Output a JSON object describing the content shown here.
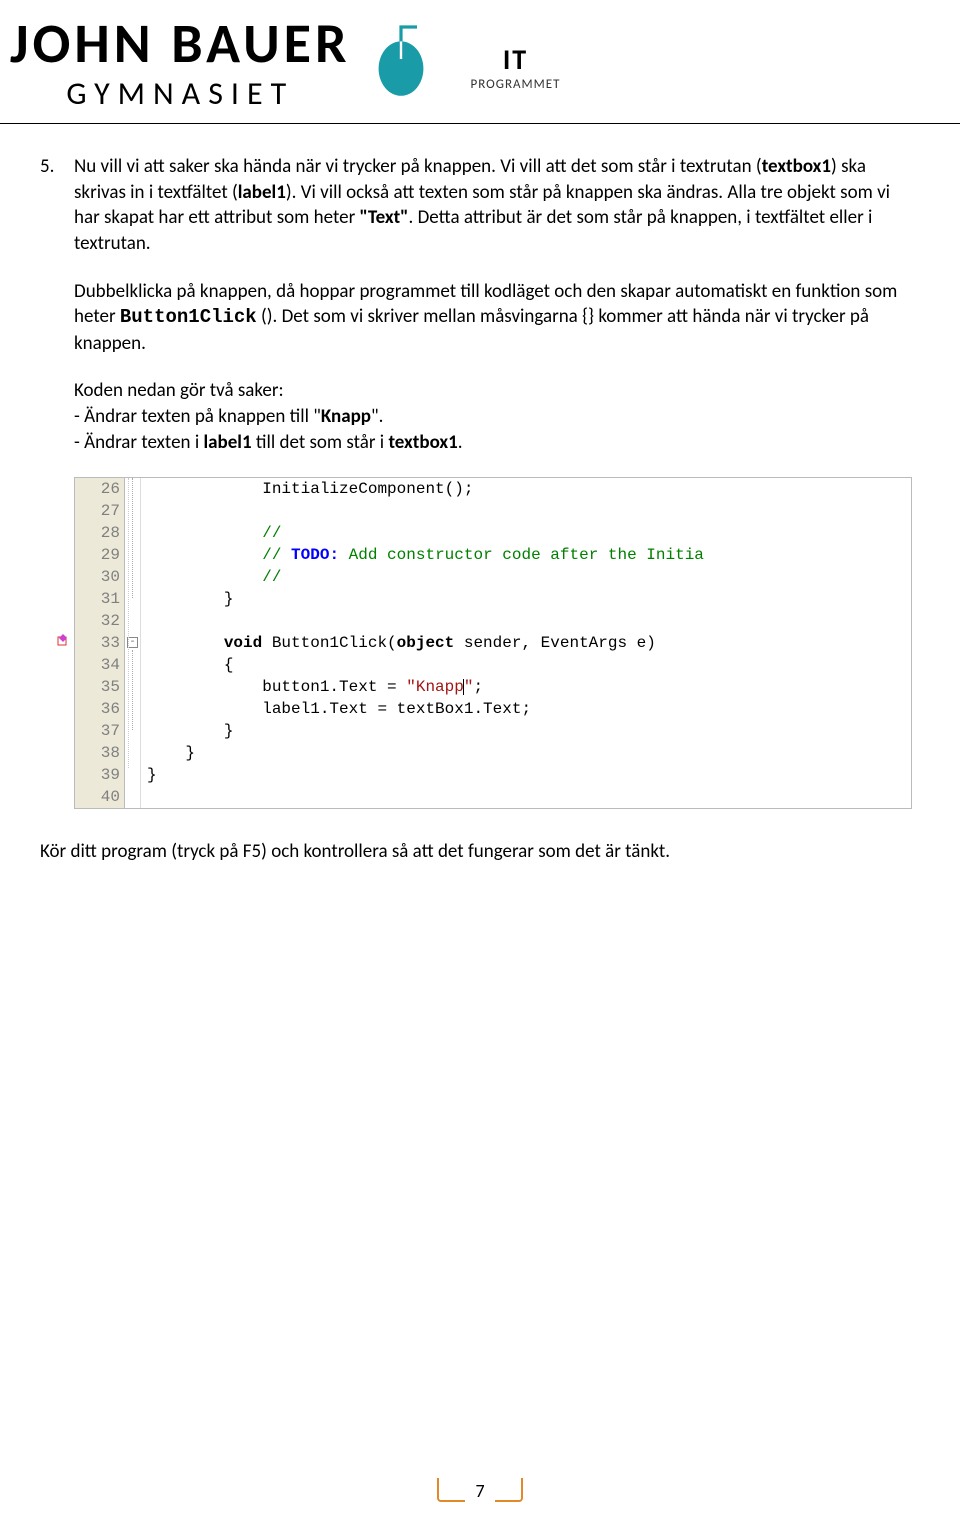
{
  "header": {
    "name_top": "JOHN BAUER",
    "name_bottom": "GYMNASIET",
    "it": "IT",
    "programmet": "PROGRAMMET"
  },
  "item": {
    "number": "5.",
    "p1_a": "Nu vill vi att saker ska hända när vi trycker på knappen. Vi vill att det som står i textrutan (",
    "p1_b": "textbox1",
    "p1_c": ") ska skrivas in i textfältet (",
    "p1_d": "label1",
    "p1_e": "). Vi vill också att texten som står på knappen ska ändras. Alla tre objekt som vi har skapat har ett attribut som heter ",
    "p1_f": "\"Text\"",
    "p1_g": ". Detta attribut är det som står på knappen, i textfältet eller i textrutan.",
    "p2_a": "Dubbelklicka på knappen, då hoppar programmet till kodläget och den skapar automatiskt en funktion som heter ",
    "p2_b": "Button1Click",
    "p2_c": " (). Det som vi skriver mellan måsvingarna {} kommer att hända när vi trycker på knappen.",
    "p3": "Koden nedan gör två saker:",
    "p3a_a": "- Ändrar texten på knappen till \"",
    "p3a_b": "Knapp",
    "p3a_c": "\".",
    "p3b_a": "- Ändrar texten i ",
    "p3b_b": "label1",
    "p3b_c": " till det som står i ",
    "p3b_d": "textbox1",
    "p3b_e": "."
  },
  "code": {
    "lines": [
      "26",
      "27",
      "28",
      "29",
      "30",
      "31",
      "32",
      "33",
      "34",
      "35",
      "36",
      "37",
      "38",
      "39",
      "40"
    ],
    "l26": "            InitializeComponent();",
    "l27": "",
    "l28": "            //",
    "l29a": "            // ",
    "l29b": "TODO:",
    "l29c": " Add constructor code after the Initia",
    "l30": "            //",
    "l31": "        }",
    "l32": "",
    "l33a": "        ",
    "l33b": "void",
    "l33c": " Button1Click(",
    "l33d": "object",
    "l33e": " sender, EventArgs e)",
    "l34": "        {",
    "l35a": "            button1.Text = ",
    "l35b": "\"Knapp",
    "l35c": "\"",
    "l35d": ";",
    "l36": "            label1.Text = textBox1.Text;",
    "l37": "        }",
    "l38": "    }",
    "l39": "}",
    "l40": ""
  },
  "after": "Kör ditt program (tryck på F5) och kontrollera så att det fungerar som det är tänkt.",
  "page": "7"
}
